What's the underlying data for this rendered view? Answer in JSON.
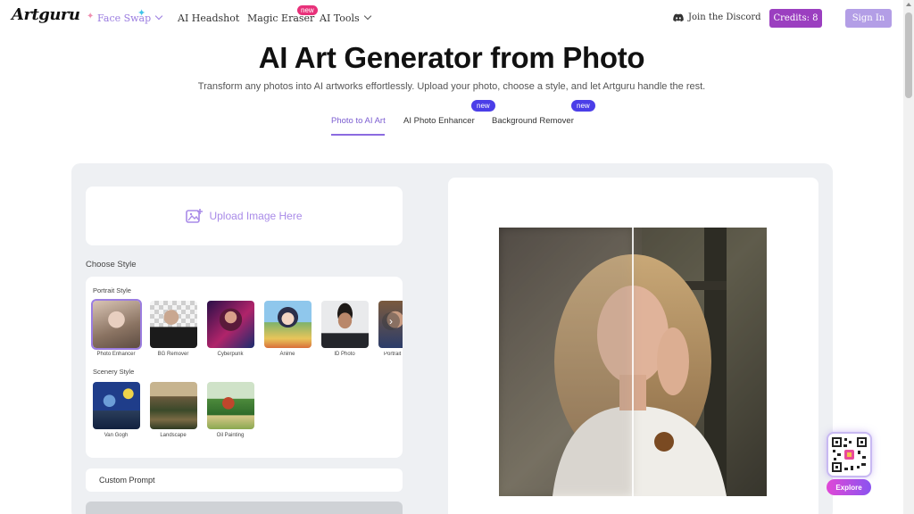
{
  "header": {
    "logo": "Artguru",
    "nav": {
      "face_swap": "Face Swap",
      "ai_headshot": "AI Headshot",
      "magic_eraser": "Magic Eraser",
      "magic_eraser_badge": "new",
      "ai_tools": "AI Tools"
    },
    "discord": "Join the Discord",
    "credits": "Credits: 8",
    "sign_in": "Sign In"
  },
  "hero": {
    "title": "AI Art Generator from Photo",
    "subtitle": "Transform any photos into AI artworks effortlessly. Upload your photo, choose a style, and let Artguru handle the rest."
  },
  "tabs": [
    {
      "label": "Photo to AI Art",
      "active": true
    },
    {
      "label": "AI Photo Enhancer",
      "badge": "new"
    },
    {
      "label": "Background Remover",
      "badge": "new"
    }
  ],
  "upload": {
    "label": "Upload Image Here"
  },
  "styles": {
    "heading": "Choose Style",
    "portrait_label": "Portrait Style",
    "portrait": [
      "Photo Enhancer",
      "BG Remover",
      "Cyberpunk",
      "Anime",
      "ID Photo",
      "Portrait"
    ],
    "scenery_label": "Scenery Style",
    "scenery": [
      "Van Gogh",
      "Landscape",
      "Oil Painting"
    ]
  },
  "custom_prompt": "Custom Prompt",
  "explore": "Explore",
  "colors": {
    "accent": "#9b7de0",
    "credits_bg": "#9b3fc0",
    "badge_blue": "#4b3ee8",
    "badge_pink": "#e8317a"
  }
}
